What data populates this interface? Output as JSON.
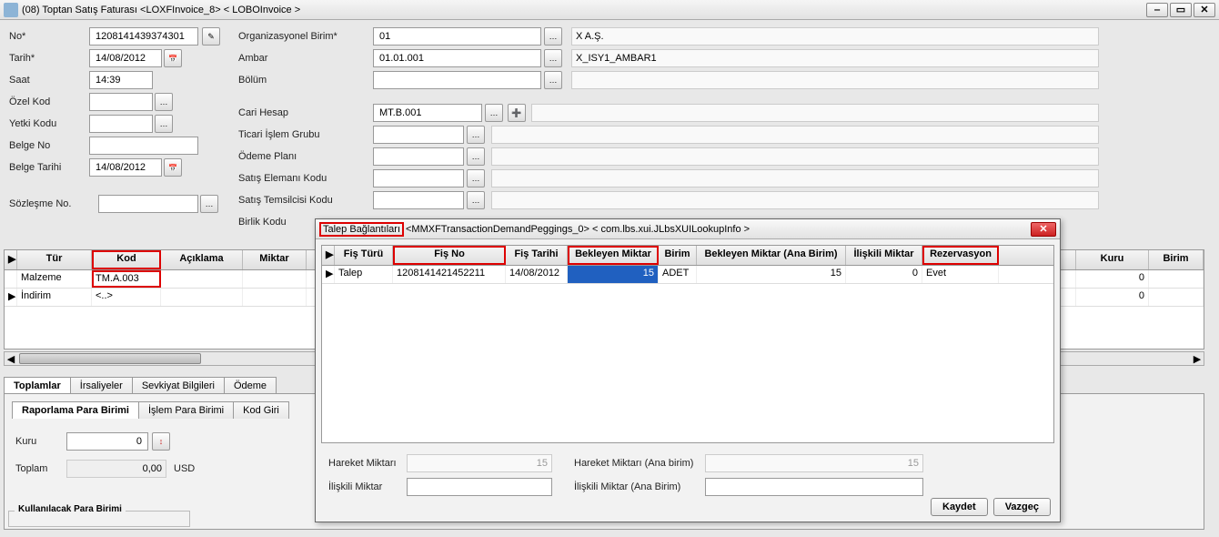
{
  "window": {
    "title": "(08) Toptan Satış Faturası <LOXFInvoice_8> < LOBOInvoice >"
  },
  "form": {
    "no_lbl": "No*",
    "no_val": "1208141439374301",
    "tarih_lbl": "Tarih*",
    "tarih_val": "14/08/2012",
    "saat_lbl": "Saat",
    "saat_val": "14:39",
    "ozelkod_lbl": "Özel Kod",
    "yetkikodu_lbl": "Yetki Kodu",
    "belgeno_lbl": "Belge No",
    "belgetarihi_lbl": "Belge Tarihi",
    "belgetarihi_val": "14/08/2012",
    "sozlesmeno_lbl": "Sözleşme No.",
    "orgbirim_lbl": "Organizasyonel Birim*",
    "orgbirim_val": "01",
    "orgbirim_disp": "X A.Ş.",
    "ambar_lbl": "Ambar",
    "ambar_val": "01.01.001",
    "ambar_disp": "X_ISY1_AMBAR1",
    "bolum_lbl": "Bölüm",
    "carihesap_lbl": "Cari Hesap",
    "carihesap_val": "MT.B.001",
    "ticariisl_lbl": "Ticari İşlem Grubu",
    "odemeplani_lbl": "Ödeme Planı",
    "satiseleman_lbl": "Satış Elemanı Kodu",
    "satistemsilci_lbl": "Satış Temsilcisi Kodu",
    "birlikkodu_lbl": "Birlik Kodu"
  },
  "grid_main": {
    "heads": {
      "tur": "Tür",
      "kod": "Kod",
      "aciklama": "Açıklama",
      "miktar": "Miktar",
      "kuru": "Kuru",
      "birim": "Birim"
    },
    "rows": [
      {
        "tur": "Malzeme",
        "kod": "TM.A.003",
        "aciklama": "",
        "miktar": "",
        "kuru": "0",
        "birim": ""
      },
      {
        "tur": "İndirim",
        "kod": "<..>",
        "aciklama": "",
        "miktar": "",
        "kuru": "0",
        "birim": ""
      }
    ]
  },
  "tabs": {
    "toplamlar": "Toplamlar",
    "irsaliyeler": "İrsaliyeler",
    "sevkiyat": "Sevkiyat Bilgileri",
    "odeme": "Ödeme"
  },
  "subtabs": {
    "raporlama": "Raporlama Para Birimi",
    "islem": "İşlem Para Birimi",
    "kodgiri": "Kod Giri"
  },
  "totals": {
    "kuru_lbl": "Kuru",
    "kuru_val": "0",
    "toplam_lbl": "Toplam",
    "toplam_val": "0,00",
    "toplam_cur": "USD",
    "kullanilacak": "Kullanılacak Para Birimi"
  },
  "dialog": {
    "title_prefix": "Talep Bağlantıları",
    "title_rest": "<MMXFTransactionDemandPeggings_0> < com.lbs.xui.JLbsXUILookupInfo >",
    "heads": {
      "fisturu": "Fiş Türü",
      "fisno": "Fiş No",
      "fistarihi": "Fiş Tarihi",
      "bekleyen": "Bekleyen Miktar",
      "birim": "Birim",
      "bekleyenana": "Bekleyen Miktar (Ana Birim)",
      "iliskili": "İlişkili Miktar",
      "rezervasyon": "Rezervasyon"
    },
    "row": {
      "fisturu": "Talep",
      "fisno": "1208141421452211",
      "fistarihi": "14/08/2012",
      "bekleyen": "15",
      "birim": "ADET",
      "bekleyenana": "15",
      "iliskili": "0",
      "rezervasyon": "Evet"
    },
    "hareketmiktar_lbl": "Hareket Miktarı",
    "hareketmiktar_val": "15",
    "hareketmiktarana_lbl": "Hareket Miktarı (Ana birim)",
    "hareketmiktarana_val": "15",
    "iliskilimiktar_lbl": "İlişkili Miktar",
    "iliskilimiktar_val": "",
    "iliskilimiktarana_lbl": "İlişkili Miktar (Ana Birim)",
    "iliskilimiktarana_val": "",
    "kaydet": "Kaydet",
    "vazgec": "Vazgeç"
  }
}
